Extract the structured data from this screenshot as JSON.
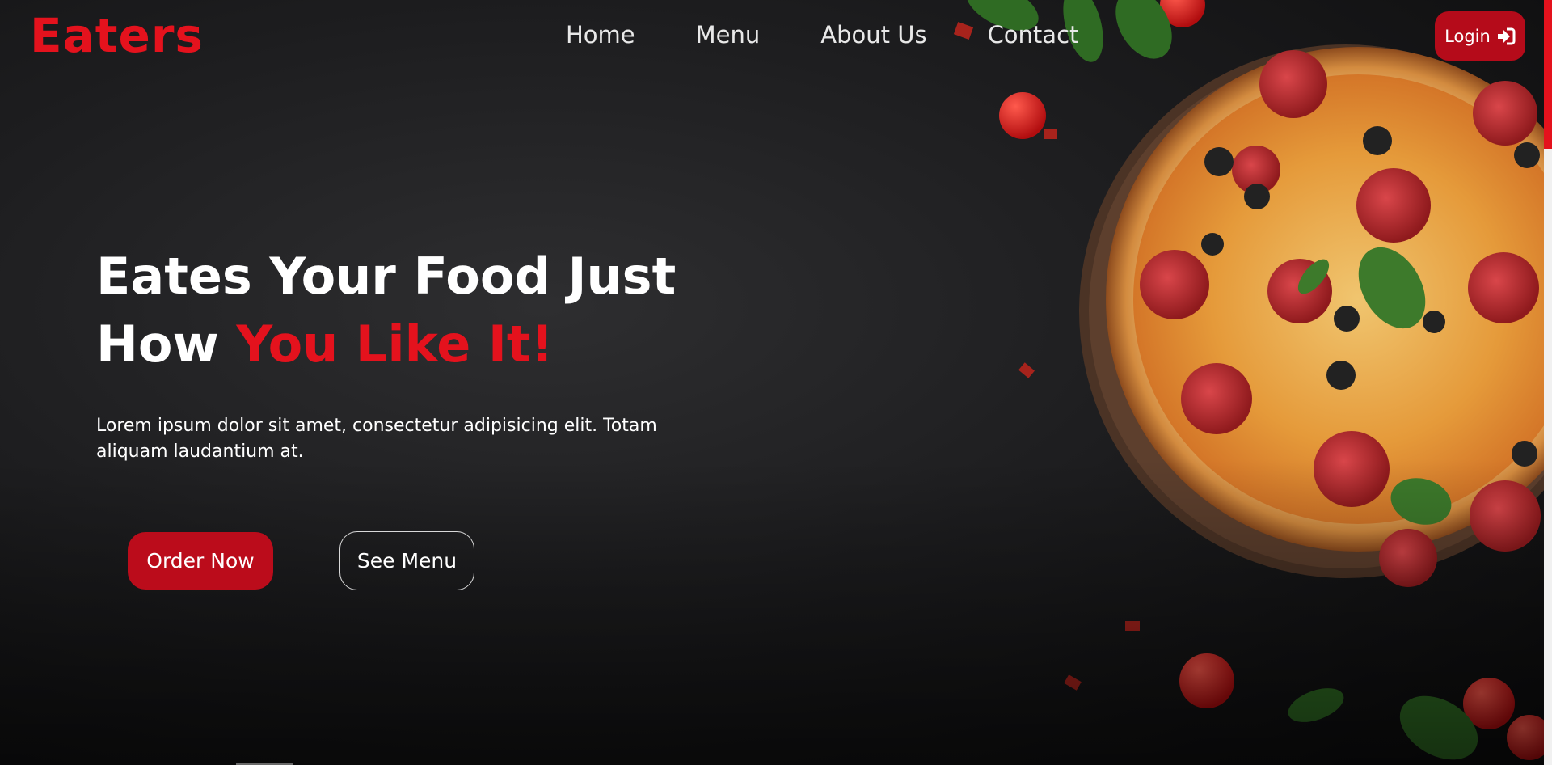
{
  "brand": {
    "logo_text": "Eaters",
    "accent_color": "#e4121d"
  },
  "nav": {
    "items": [
      {
        "label": "Home"
      },
      {
        "label": "Menu"
      },
      {
        "label": "About Us"
      },
      {
        "label": "Contact"
      }
    ],
    "login_label": "Login",
    "login_icon": "sign-in-icon",
    "login_color": "#b50b1a"
  },
  "hero": {
    "headline_line1": "Eates Your Food Just",
    "headline_line2_prefix": "How",
    "headline_line2_accent": "You Like It!",
    "description": "Lorem ipsum dolor sit amet, consectetur adipisicing elit. Totam aliquam laudantium at.",
    "order_button_label": "Order Now",
    "menu_button_label": "See Menu",
    "image": "pizza-photo"
  }
}
